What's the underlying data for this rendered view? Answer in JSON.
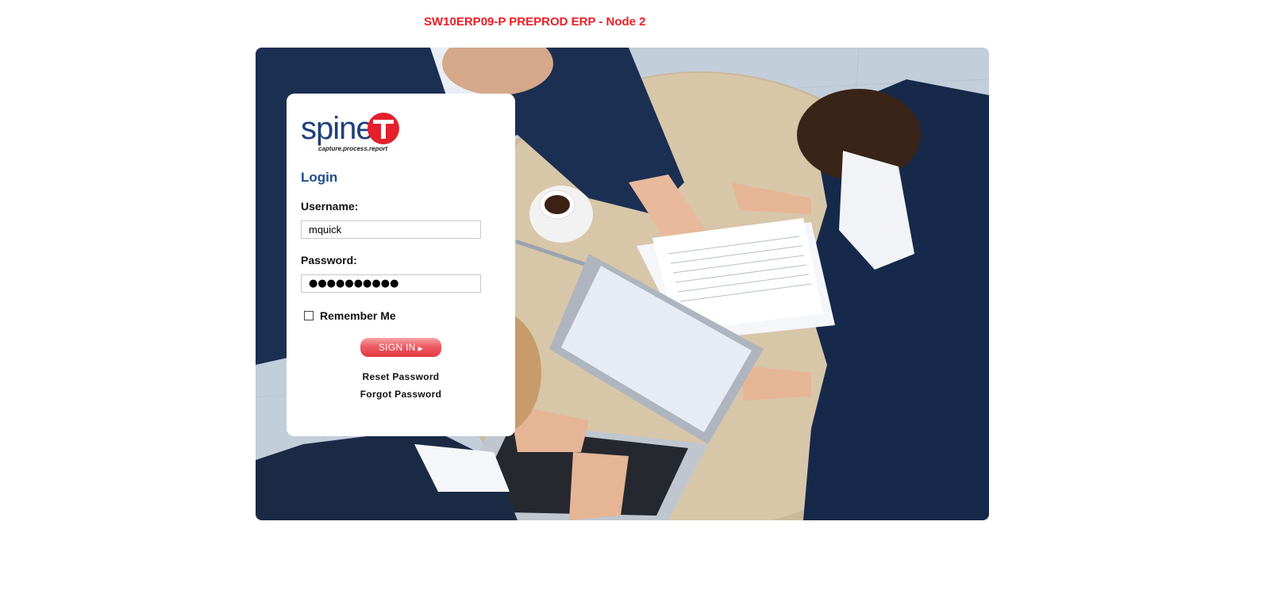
{
  "header": {
    "environment_title": "SW10ERP09-P PREPROD ERP - Node 2"
  },
  "brand": {
    "name": "spine",
    "badge_letter": "T",
    "tagline": "capture.process.report",
    "primary_color": "#1f3f7a",
    "accent_color": "#e3202c"
  },
  "login": {
    "heading": "Login",
    "username_label": "Username:",
    "username_value": "mquick",
    "password_label": "Password:",
    "password_masked": "●●●●●●●●●●",
    "remember_label": "Remember Me",
    "remember_checked": false,
    "signin_label": "SIGN IN",
    "signin_arrow": "▶",
    "reset_password_link": "Reset Password",
    "forgot_password_link": "Forgot Password"
  },
  "colors": {
    "title_red": "#ee1c24",
    "heading_blue": "#1f4e8c",
    "button_red": "#e23840"
  },
  "icons": {
    "hero": "business-meeting-photo",
    "logo": "spineit-logo"
  }
}
